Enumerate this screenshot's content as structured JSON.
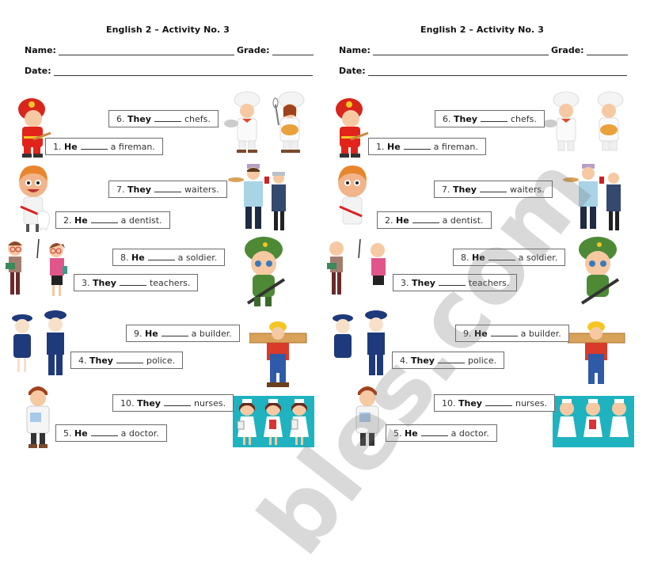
{
  "worksheet": {
    "title": "English 2 – Activity No. 3",
    "name_label": "Name:",
    "grade_label": "Grade:",
    "date_label": "Date:",
    "items": [
      {
        "num": "1.",
        "subject": "He",
        "rest": "a fireman."
      },
      {
        "num": "2.",
        "subject": "He",
        "rest": "a dentist."
      },
      {
        "num": "3.",
        "subject": "They",
        "rest": "teachers."
      },
      {
        "num": "4.",
        "subject": "They",
        "rest": "police."
      },
      {
        "num": "5.",
        "subject": "He",
        "rest": "a doctor."
      },
      {
        "num": "6.",
        "subject": "They",
        "rest": "chefs."
      },
      {
        "num": "7.",
        "subject": "They",
        "rest": "waiters."
      },
      {
        "num": "8.",
        "subject": "He",
        "rest": "a soldier."
      },
      {
        "num": "9.",
        "subject": "He",
        "rest": "a builder."
      },
      {
        "num": "10.",
        "subject": "They",
        "rest": "nurses."
      }
    ],
    "illustrations": {
      "fireman": "fireman-illustration",
      "chefs": "chefs-illustration",
      "dentist": "dentist-illustration",
      "waiters": "waiters-illustration",
      "teachers": "teachers-illustration",
      "soldier": "soldier-illustration",
      "police": "police-illustration",
      "builder": "builder-illustration",
      "doctor": "doctor-illustration",
      "nurses": "nurses-illustration"
    },
    "colors": {
      "nurse_bg": "#1fb3bf",
      "box_border": "#6b6b6b"
    }
  },
  "watermark": "bles.com"
}
